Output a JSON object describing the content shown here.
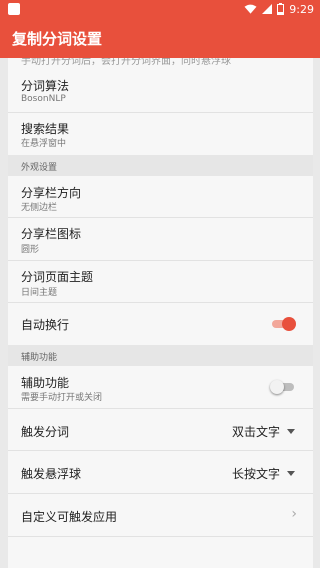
{
  "status_bar": {
    "time": "9:29",
    "battery_level": "9"
  },
  "app_bar": {
    "title": "复制分词设置"
  },
  "top_partial_text": "手动打开分词后，会打开分词界面，同时悬浮球",
  "settings": [
    {
      "title": "分词算法",
      "subtitle": "BosonNLP"
    },
    {
      "title": "搜索结果",
      "subtitle": "在悬浮窗中"
    }
  ],
  "sections": {
    "appearance": "外观设置",
    "accessibility": "辅助功能"
  },
  "appearance_items": [
    {
      "title": "分享栏方向",
      "subtitle": "无侧边栏"
    },
    {
      "title": "分享栏图标",
      "subtitle": "圆形"
    },
    {
      "title": "分词页面主题",
      "subtitle": "日间主题"
    }
  ],
  "auto_wrap": {
    "title": "自动换行",
    "enabled": true
  },
  "accessibility_item": {
    "title": "辅助功能",
    "subtitle": "需要手动打开或关闭",
    "enabled": false
  },
  "trigger_segment": {
    "title": "触发分词",
    "value": "双击文字"
  },
  "trigger_float": {
    "title": "触发悬浮球",
    "value": "长按文字"
  },
  "custom_apps": {
    "title": "自定义可触发应用"
  },
  "colors": {
    "accent": "#e8503c"
  }
}
